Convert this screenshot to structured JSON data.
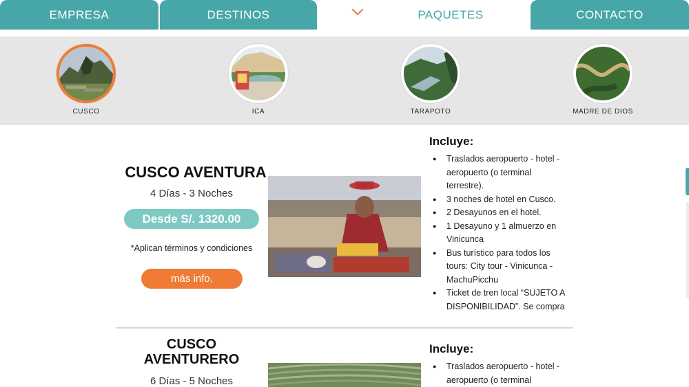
{
  "nav": {
    "tabs": [
      {
        "label": "EMPRESA"
      },
      {
        "label": "DESTINOS"
      },
      {
        "label": "PAQUETES"
      },
      {
        "label": "CONTACTO"
      }
    ],
    "active_tab": "PAQUETES"
  },
  "destinations": [
    {
      "label": "CUSCO",
      "active": true
    },
    {
      "label": "ICA"
    },
    {
      "label": "TARAPOTO"
    },
    {
      "label": "MADRE DE DIOS"
    }
  ],
  "packages": [
    {
      "title": "CUSCO AVENTURA",
      "duration": "4 Días - 3 Noches",
      "price": "Desde S/. 1320.00",
      "terms": "*Aplican términos y condiciones",
      "cta": "más info.",
      "includes_title": "Incluye:",
      "includes": [
        "Traslados aeropuerto - hotel - aeropuerto (o terminal terrestre).",
        " 3 noches de hotel en Cusco.",
        "2 Desayunos en el hotel.",
        "1 Desayuno y 1 almuerzo en Vinicunca",
        "Bus turístico para todos los tours: City tour - Vinicunca - MachuPicchu",
        "Ticket de tren local “SUJETO A DISPONIBILIDAD”. Se compra"
      ]
    },
    {
      "title": "CUSCO AVENTURERO",
      "duration": "6 Días - 5 Noches",
      "includes_title": "Incluye:",
      "includes": [
        "Traslados aeropuerto - hotel - aeropuerto (o terminal"
      ]
    }
  ],
  "colors": {
    "teal": "#47a6a8",
    "light_teal": "#7ec9c4",
    "orange": "#ef7b35",
    "strip_bg": "#e6e6e6"
  }
}
